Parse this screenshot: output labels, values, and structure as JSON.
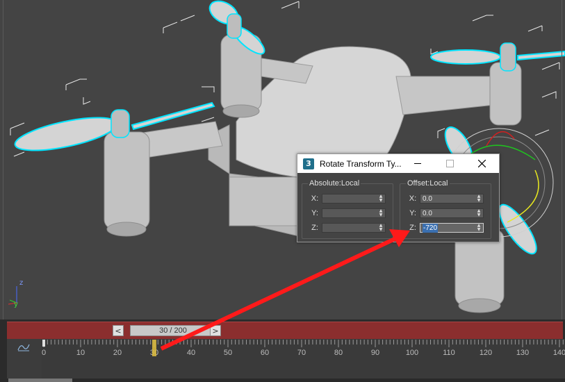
{
  "dialog": {
    "title": "Rotate Transform Ty...",
    "app_icon": "3",
    "absolute": {
      "legend": "Absolute:Local",
      "fields": [
        {
          "label": "X:",
          "value": ""
        },
        {
          "label": "Y:",
          "value": ""
        },
        {
          "label": "Z:",
          "value": ""
        }
      ]
    },
    "offset": {
      "legend": "Offset:Local",
      "fields": [
        {
          "label": "X:",
          "value": "0.0"
        },
        {
          "label": "Y:",
          "value": "0.0"
        },
        {
          "label": "Z:",
          "value": "-720"
        }
      ]
    },
    "minimize_icon": "minimize-icon",
    "maximize_icon": "maximize-icon",
    "close_icon": "close-icon"
  },
  "timeline": {
    "frame_display": "30 / 200",
    "prev_label": "<",
    "next_label": ">",
    "ticks": [
      "0",
      "10",
      "20",
      "30",
      "40",
      "50",
      "60",
      "70",
      "80",
      "90",
      "100",
      "110",
      "120",
      "130",
      "140"
    ],
    "current_frame": 30
  },
  "axis": {
    "z": "z",
    "y": "y",
    "x": "x"
  },
  "colors": {
    "selection": "#00e5ff",
    "timeslider": "#8b2e2e",
    "arrow": "#ff1a1a",
    "key": "#e0c040"
  }
}
